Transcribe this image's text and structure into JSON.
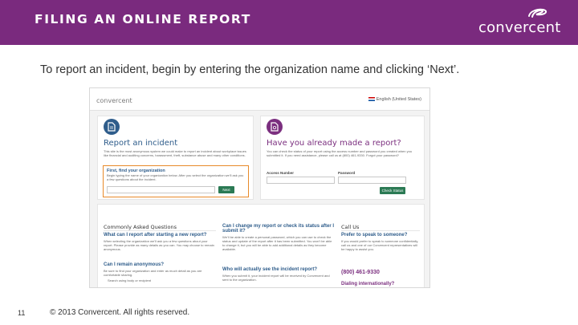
{
  "header": {
    "title": "FILING AN ONLINE REPORT",
    "logo_text": "convercent",
    "background": "#7a2a7e"
  },
  "subtitle": "To report an incident, begin by entering the organization name and clicking ‘Next’.",
  "screenshot": {
    "logo": "convercent",
    "language": "English (United States)",
    "left_panel": {
      "icon": "document-icon",
      "title": "Report an incident",
      "text": "This site is the most anonymous system we could make to report an incident about workplace issues like financial and auditing concerns, harassment, theft, substance abuse and many other conditions.",
      "find": {
        "title": "First, find your organization",
        "text": "Begin typing the name of your organization below. After you select the organization we’ll ask you a few questions about the incident.",
        "button": "Next"
      }
    },
    "right_panel": {
      "icon": "document-search-icon",
      "title": "Have you already made a report?",
      "text": "You can check the status of your report using the access number and password you created when you submitted it. If you need assistance, please call us at (800) 461-9330. Forgot your password?",
      "access_label": "Access Number",
      "password_label": "Password",
      "button": "Check Status"
    },
    "faq": {
      "heading": "Commonly Asked Questions",
      "col1": [
        {
          "q": "What can I report after starting a new report?",
          "a": "When selecting the organization we’ll ask you a few questions about your report. Please provide as many details as you can. You may choose to remain anonymous."
        },
        {
          "q": "Can I remain anonymous?",
          "a": "Be sure to find your organization and enter as much detail as you are comfortable sharing."
        },
        {
          "q": "",
          "a": "Search using body or recipient"
        }
      ],
      "col2": [
        {
          "q": "Can I change my report or check its status after I submit it?",
          "a": "We’ll be able to create a personal password, which you can use to check the status and update of the report after it has been submitted. You won’t be able to change it, but you will be able to add additional details as they become available."
        },
        {
          "q": "Who will actually see the incident report?",
          "a": "When you submit it, your incident report will be received by Convercent and sent to the organization."
        }
      ],
      "call_us": {
        "heading": "Call Us",
        "q": "Prefer to speak to someone?",
        "a": "If you would prefer to speak to someone confidentially, call us and one of our Convercent representatives will be happy to assist you.",
        "phone": "(800) 461-9330",
        "dialing": "Dialing internationally?"
      }
    }
  },
  "footer": {
    "page_number": "11",
    "copyright": "© 2013 Convercent. All rights reserved."
  }
}
